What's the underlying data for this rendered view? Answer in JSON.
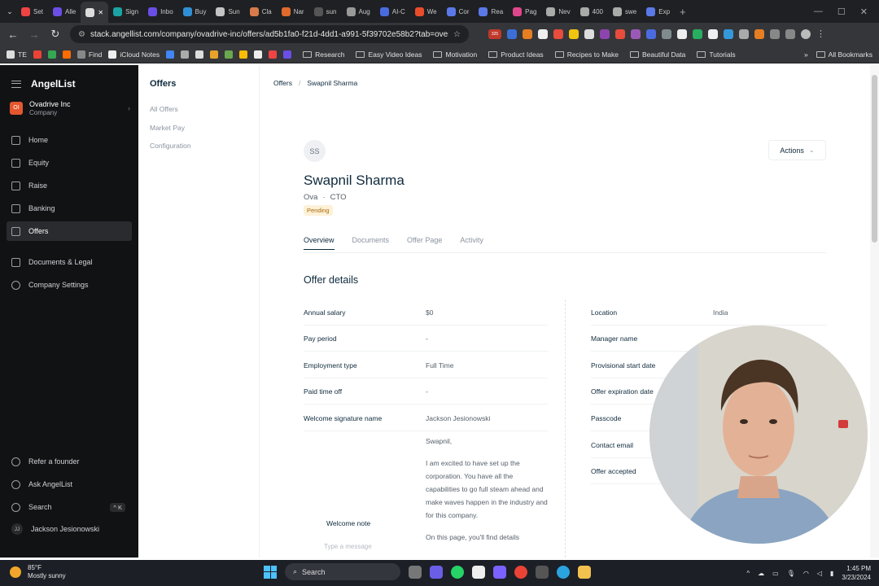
{
  "browser": {
    "tabs": [
      {
        "label": "Set",
        "color": "#e44"
      },
      {
        "label": "Alle",
        "color": "#6b4ee6"
      },
      {
        "label": "",
        "color": "#ddd",
        "active": true
      },
      {
        "label": "Sign",
        "color": "#1aa3a3"
      },
      {
        "label": "Inbo",
        "color": "#6b4ee6"
      },
      {
        "label": "Buy",
        "color": "#2f8fd6"
      },
      {
        "label": "Sun",
        "color": "#c4c4c4"
      },
      {
        "label": "Cla",
        "color": "#d77b4a"
      },
      {
        "label": "Nar",
        "color": "#e06a2c"
      },
      {
        "label": "sun",
        "color": "#555"
      },
      {
        "label": "Aug",
        "color": "#999"
      },
      {
        "label": "AI-C",
        "color": "#4a6be0"
      },
      {
        "label": "We",
        "color": "#e84d2a"
      },
      {
        "label": "Cor",
        "color": "#5a79e8"
      },
      {
        "label": "Rea",
        "color": "#5a79e8"
      },
      {
        "label": "Pag",
        "color": "#e0468b"
      },
      {
        "label": "Nev",
        "color": "#aaa"
      },
      {
        "label": "400",
        "color": "#aaa"
      },
      {
        "label": "swe",
        "color": "#aaa"
      },
      {
        "label": "Exp",
        "color": "#5a79e8"
      }
    ],
    "url": "stack.angellist.com/company/ovadrive-inc/offers/ad5b1fa0-f21d-4dd1-a991-5f39702e58b2?tab=overview",
    "extensions_badge": "325",
    "bookmarks": [
      {
        "label": "TE",
        "color": "#ddd"
      },
      {
        "label": "",
        "color": "#ea4335"
      },
      {
        "label": "",
        "color": "#34a853"
      },
      {
        "label": "",
        "color": "#ff6d00"
      },
      {
        "label": "Find",
        "color": "#888"
      },
      {
        "label": "iCloud Notes",
        "color": "#eee"
      },
      {
        "label": "",
        "color": "#4285f4"
      },
      {
        "label": "",
        "color": "#aaa"
      },
      {
        "label": "",
        "color": "#ddd"
      },
      {
        "label": "",
        "color": "#e8a22a"
      },
      {
        "label": "",
        "color": "#6aa84f"
      },
      {
        "label": "",
        "color": "#fbbc05"
      },
      {
        "label": "",
        "color": "#eee"
      },
      {
        "label": "",
        "color": "#e44"
      },
      {
        "label": "",
        "color": "#6b4ee6"
      }
    ],
    "folders": [
      "Research",
      "Easy Video Ideas",
      "Motivation",
      "Product Ideas",
      "Recipes to Make",
      "Beautiful Data",
      "Tutorials"
    ],
    "all_bookmarks": "All Bookmarks"
  },
  "sidebar": {
    "brand": "AngelList",
    "company_initials": "OI",
    "company_name": "Ovadrive Inc",
    "company_type": "Company",
    "items": [
      {
        "label": "Home",
        "icon": "home-icon"
      },
      {
        "label": "Equity",
        "icon": "equity-icon"
      },
      {
        "label": "Raise",
        "icon": "raise-icon"
      },
      {
        "label": "Banking",
        "icon": "bank-icon"
      },
      {
        "label": "Offers",
        "icon": "offers-icon",
        "active": true
      },
      {
        "label": "Documents & Legal",
        "icon": "documents-icon"
      },
      {
        "label": "Company Settings",
        "icon": "gear-icon"
      }
    ],
    "bottom": [
      {
        "label": "Refer a founder",
        "icon": "refer-icon"
      },
      {
        "label": "Ask AngelList",
        "icon": "sparkle-icon"
      },
      {
        "label": "Search",
        "icon": "search-icon",
        "shortcut": "^ K"
      }
    ],
    "user_initials": "JJ",
    "user_name": "Jackson Jesionowski"
  },
  "subnav": {
    "title": "Offers",
    "items": [
      "All Offers",
      "Market Pay",
      "Configuration"
    ]
  },
  "main": {
    "breadcrumb": [
      "Offers",
      "Swapnil Sharma"
    ],
    "avatar_initials": "SS",
    "actions_label": "Actions",
    "name": "Swapnil Sharma",
    "company": "Ova",
    "role": "CTO",
    "status": "Pending",
    "tabs": [
      "Overview",
      "Documents",
      "Offer Page",
      "Activity"
    ],
    "section_title": "Offer details",
    "left_rows": [
      {
        "label": "Annual salary",
        "value": "$0"
      },
      {
        "label": "Pay period",
        "value": "-"
      },
      {
        "label": "Employment type",
        "value": "Full Time"
      },
      {
        "label": "Paid time off",
        "value": "-"
      },
      {
        "label": "Welcome signature name",
        "value": "Jackson Jesionowski"
      }
    ],
    "welcome_note_label": "Welcome note",
    "welcome_note": {
      "greeting": "Swapnil,",
      "p1": "I am excited to have set up the corporation. You have all the capabilities to go full steam ahead and make waves happen in the industry and for this company.",
      "p2": "On this page, you'll find details"
    },
    "right_rows": [
      {
        "label": "Location",
        "value": "India"
      },
      {
        "label": "Manager name",
        "value": ""
      },
      {
        "label": "Provisional start date",
        "value": ""
      },
      {
        "label": "Offer expiration date",
        "value": ""
      },
      {
        "label": "Passcode",
        "value": ""
      },
      {
        "label": "Contact email",
        "value": ""
      },
      {
        "label": "Offer accepted",
        "value": ""
      }
    ],
    "message_placeholder": "Type a message"
  },
  "taskbar": {
    "temp": "85°F",
    "weather": "Mostly sunny",
    "search": "Search",
    "time": "1:45 PM",
    "date": "3/23/2024"
  }
}
